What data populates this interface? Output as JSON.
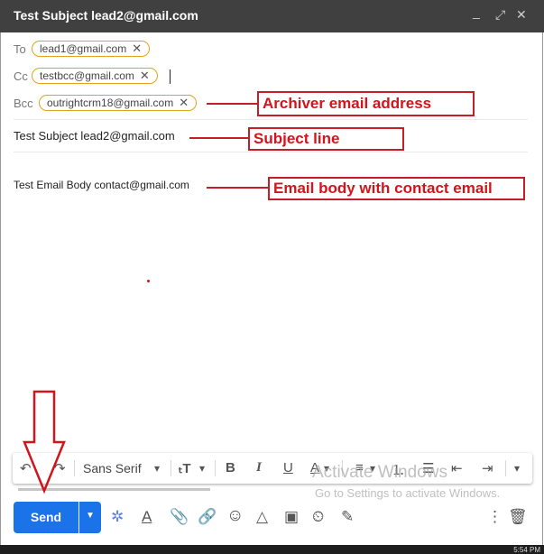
{
  "window": {
    "title": "Test Subject lead2@gmail.com",
    "minimize_glyph": "_",
    "expand_glyph": "⤢",
    "close_glyph": "✕"
  },
  "recipients": {
    "to_label": "To",
    "to_chips": [
      "lead1@gmail.com"
    ],
    "cc_label": "Cc",
    "cc_chips": [
      "testbcc@gmail.com"
    ],
    "bcc_label": "Bcc",
    "bcc_chips": [
      "outrightcrm18@gmail.com"
    ],
    "chip_remove_glyph": "✕"
  },
  "subject": "Test Subject lead2@gmail.com",
  "body": "Test Email Body contact@gmail.com",
  "annotations": {
    "archiver": "Archiver email address",
    "subject_line": "Subject line",
    "email_body": "Email body with contact email"
  },
  "formatting": {
    "undo_glyph": "↶",
    "redo_glyph": "↷",
    "font": "Sans Serif",
    "dropdown_glyph": "▾",
    "size_glyph": "ₜT",
    "bold": "B",
    "italic": "I",
    "underline": "U",
    "text_color": "A",
    "align_glyph": "≡",
    "numbered_glyph": "⒈",
    "bulleted_glyph": "☰",
    "indent_less_glyph": "⇤",
    "indent_more_glyph": "⇥"
  },
  "watermark": {
    "line1": "Activate Windows",
    "line2": "Go to Settings to activate Windows."
  },
  "footer": {
    "send_label": "Send",
    "send_menu_glyph": "▼",
    "more_glyph": "⋮",
    "trash_glyph": "🗑",
    "tools": {
      "ai": "✲",
      "format": "A",
      "attach": "📎",
      "link": "🔗",
      "emoji": "☺",
      "drive": "△",
      "photo": "▣",
      "confidential": "⏲",
      "signature": "✎"
    }
  },
  "taskbar": {
    "clock": "5:54 PM"
  },
  "colors": {
    "title_bar": "#404040",
    "send_blue": "#1a73e8",
    "chip_border": "#e0a41a",
    "annotation_red": "#c41e2a"
  }
}
